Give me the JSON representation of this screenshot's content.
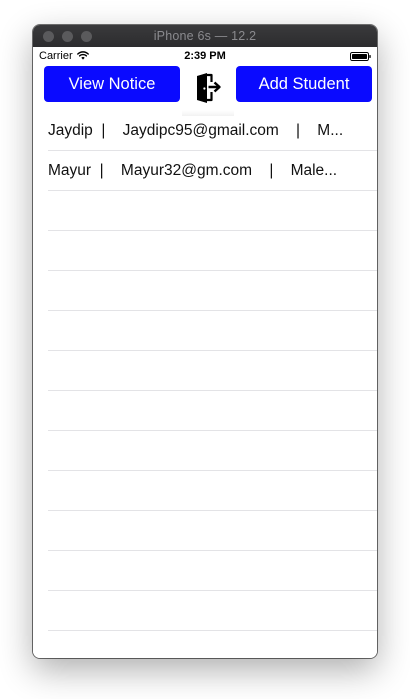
{
  "window": {
    "title": "iPhone 6s — 12.2"
  },
  "status_bar": {
    "carrier": "Carrier",
    "time": "2:39 PM"
  },
  "toolbar": {
    "view_notice_label": "View Notice",
    "add_student_label": "Add Student",
    "logout_icon": "logout-door-icon"
  },
  "students": [
    {
      "text": "Jaydip  |    Jaydipc95@gmail.com    |    M..."
    },
    {
      "text": "Mayur  |    Mayur32@gm.com    |    Male..."
    }
  ],
  "empty_row_count": 11,
  "colors": {
    "accent": "#0a0aff",
    "separator": "#e3e3e6",
    "titlebar": "#2f2f31"
  }
}
